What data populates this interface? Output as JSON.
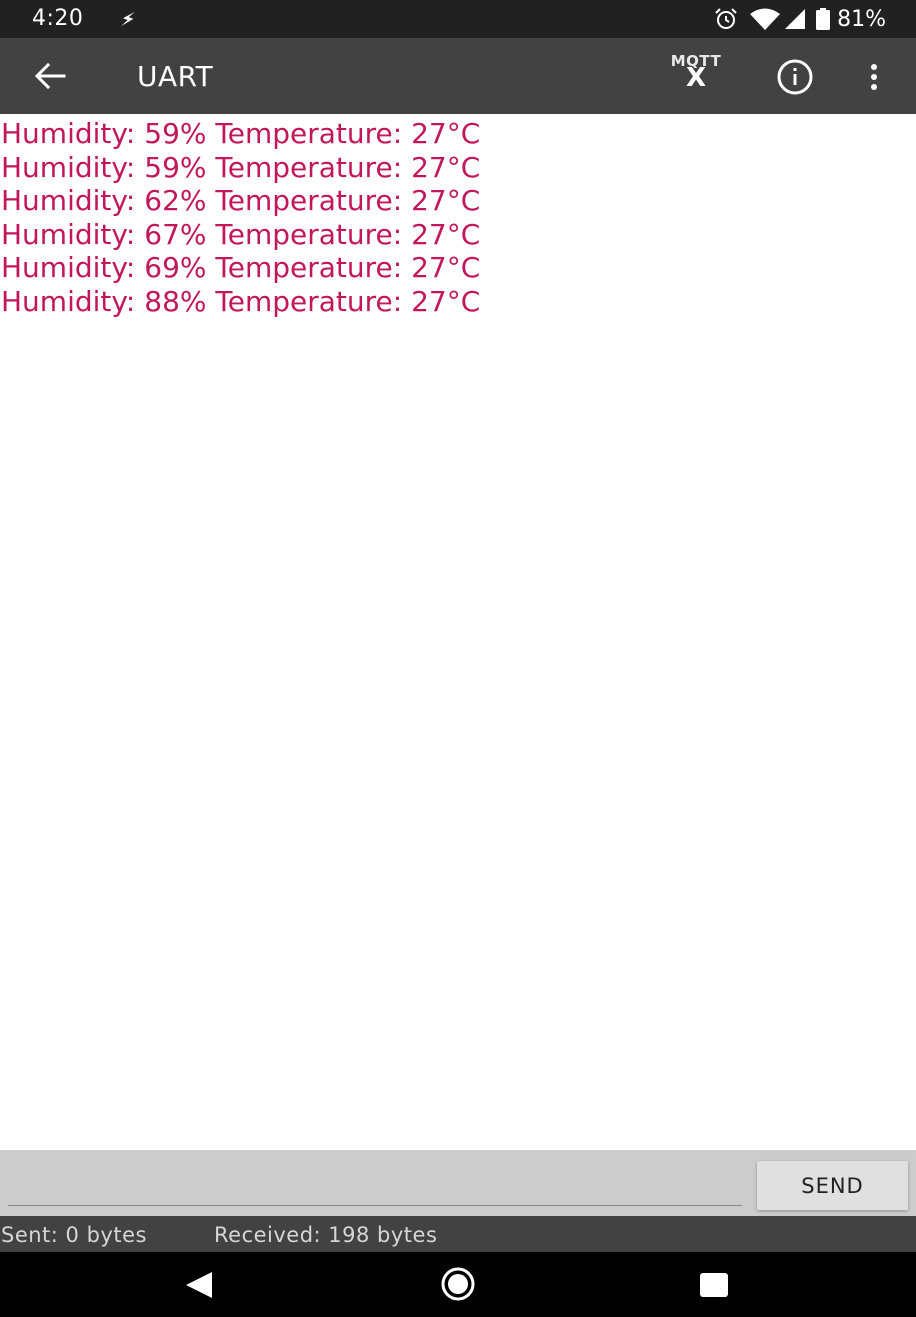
{
  "status_bar": {
    "time": "4:20",
    "battery": "81%",
    "icons": [
      "flash-icon",
      "alarm-icon",
      "wifi-icon",
      "cell-signal-icon",
      "battery-icon"
    ]
  },
  "app_bar": {
    "title": "UART",
    "mqtt_label": "MQTT",
    "mqtt_badge": "X",
    "icons": [
      "back-arrow-icon",
      "mqtt-icon",
      "info-icon",
      "more-vert-icon"
    ]
  },
  "log": {
    "color": "#c2185b",
    "lines": [
      "Humidity: 59% Temperature: 27°C",
      "Humidity: 59% Temperature: 27°C",
      "Humidity: 62% Temperature: 27°C",
      "Humidity: 67% Temperature: 27°C",
      "Humidity: 69% Temperature: 27°C",
      "Humidity: 88% Temperature: 27°C"
    ]
  },
  "input": {
    "value": "",
    "send_label": "SEND"
  },
  "stats": {
    "sent": "Sent: 0 bytes",
    "received": "Received: 198 bytes"
  },
  "colors": {
    "status_bar": "#212121",
    "app_bar": "#424242",
    "input_bar": "#cccccc",
    "accent_text": "#c2185b"
  }
}
